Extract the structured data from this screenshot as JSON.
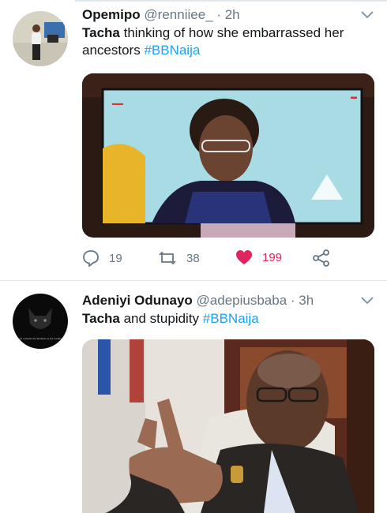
{
  "tweets": [
    {
      "name": "Opemipo",
      "handle": "@renniiee_",
      "time": "· 2h",
      "text_bold": "Tacha",
      "text_rest": " thinking of how she embarrassed her ancestors ",
      "hashtag": "#BBNaija",
      "replies": "19",
      "retweets": "38",
      "likes": "199",
      "liked": true,
      "media_icon": "tv-screen-photo"
    },
    {
      "name": "Adeniyi Odunayo",
      "handle": "@adepiusbaba",
      "time": "· 3h",
      "text_bold": "Tacha",
      "text_rest": " and stupidity ",
      "hashtag": "#BBNaija",
      "avatar_caption": "Don't consider my kindness as my weakness",
      "media_icon": "portrait-photo"
    }
  ],
  "colors": {
    "accent": "#1da1f2",
    "like": "#e0245e",
    "muted": "#657786"
  },
  "icons": [
    "chevron-down-icon",
    "reply-icon",
    "retweet-icon",
    "heart-icon",
    "share-icon"
  ]
}
